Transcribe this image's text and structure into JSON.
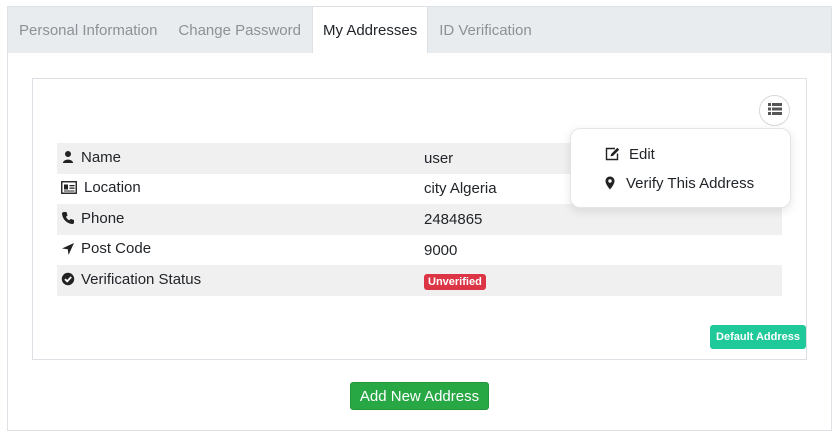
{
  "tabs": [
    {
      "label": "Personal Information",
      "active": false
    },
    {
      "label": "Change Password",
      "active": false
    },
    {
      "label": "My Addresses",
      "active": true
    },
    {
      "label": "ID Verification",
      "active": false
    }
  ],
  "address_card": {
    "menu_icon": "list-icon",
    "rows": [
      {
        "icon": "user-icon",
        "label": "Name",
        "value": "user"
      },
      {
        "icon": "id-card-icon",
        "label": "Location",
        "value": "city Algeria"
      },
      {
        "icon": "phone-icon",
        "label": "Phone",
        "value": "2484865"
      },
      {
        "icon": "location-arrow-icon",
        "label": "Post Code",
        "value": "9000"
      },
      {
        "icon": "check-circle-icon",
        "label": "Verification Status",
        "value": "Unverified"
      }
    ],
    "default_badge": "Default Address"
  },
  "dropdown": {
    "edit_label": "Edit",
    "edit_icon": "edit-icon",
    "verify_label": "Verify This Address",
    "verify_icon": "map-marker-icon"
  },
  "actions": {
    "add_new_label": "Add New Address"
  },
  "colors": {
    "unverified_badge": "#dc3545",
    "default_badge": "#1fc99a",
    "add_button": "#28a745"
  }
}
